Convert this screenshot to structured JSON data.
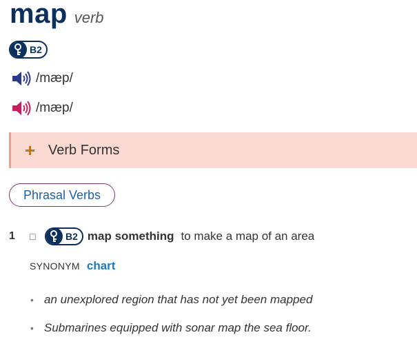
{
  "entry": {
    "headword": "map",
    "pos": "verb",
    "level": "B2"
  },
  "pronunciations": [
    {
      "variant": "british",
      "ipa": "/mæp/",
      "color": "#2d3a8c"
    },
    {
      "variant": "american",
      "ipa": "/mæp/",
      "color": "#c51f5d"
    }
  ],
  "verb_forms": {
    "label": "Verb Forms",
    "icon": "plus-icon"
  },
  "phrasal_verbs": {
    "label": "Phrasal Verbs"
  },
  "senses": [
    {
      "number": "1",
      "level": "B2",
      "pattern": "map something",
      "definition": "to make a map of an area",
      "synonym_label": "SYNONYM",
      "synonym": "chart",
      "examples": [
        "an unexplored region that has not yet been mapped",
        "Submarines equipped with sonar map the sea floor."
      ]
    }
  ],
  "colors": {
    "brand": "#0d2f5c",
    "accent_link": "#1e7bb8",
    "verb_forms_bg": "#fbdad3",
    "plus": "#c4711b"
  }
}
